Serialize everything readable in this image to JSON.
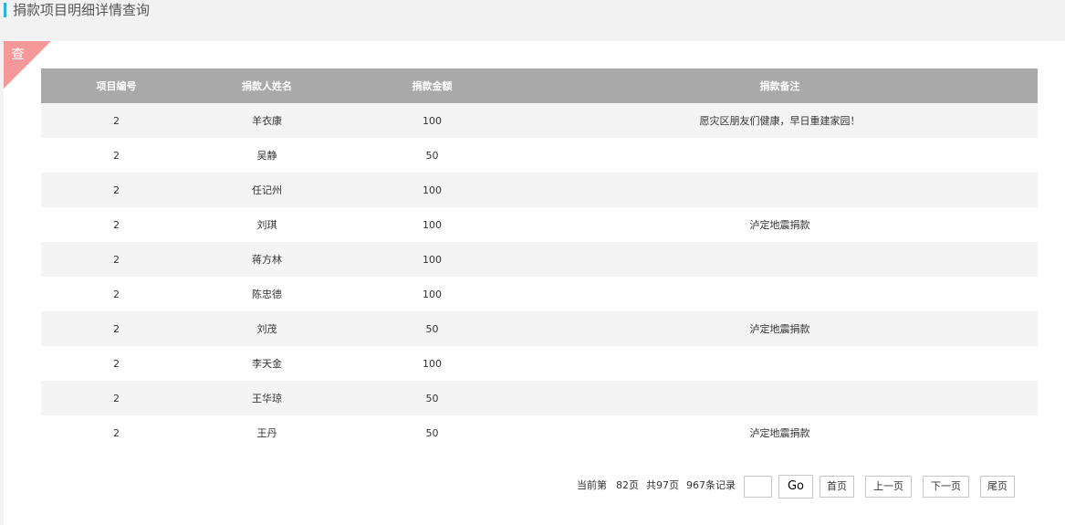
{
  "header": {
    "title": "捐款项目明细详情查询",
    "accent_color": "#29b6d9"
  },
  "corner_tag": {
    "label": "查",
    "color": "#f4989a"
  },
  "table": {
    "columns": [
      "项目编号",
      "捐款人姓名",
      "捐款金额",
      "捐款备注"
    ],
    "rows": [
      [
        "2",
        "羊衣康",
        "100",
        "愿灾区朋友们健康，早日重建家园！"
      ],
      [
        "2",
        "吴静",
        "50",
        ""
      ],
      [
        "2",
        "任记州",
        "100",
        ""
      ],
      [
        "2",
        "刘琪",
        "100",
        "泸定地震捐款"
      ],
      [
        "2",
        "蒋方林",
        "100",
        ""
      ],
      [
        "2",
        "陈忠德",
        "100",
        ""
      ],
      [
        "2",
        "刘茂",
        "50",
        "泸定地震捐款"
      ],
      [
        "2",
        "李天金",
        "100",
        ""
      ],
      [
        "2",
        "王华琼",
        "50",
        ""
      ],
      [
        "2",
        "王丹",
        "50",
        "泸定地震捐款"
      ]
    ],
    "header_color": "#a9a9a9",
    "stripe_color": "#f4f4f4"
  },
  "pager": {
    "current_prefix": "当前第",
    "current_page": "82页",
    "total_pages": "共97页",
    "total_records": "967条记录",
    "page_input_value": "",
    "go_label": "Go",
    "first_label": "首页",
    "prev_label": "上一页",
    "next_label": "下一页",
    "last_label": "尾页"
  }
}
